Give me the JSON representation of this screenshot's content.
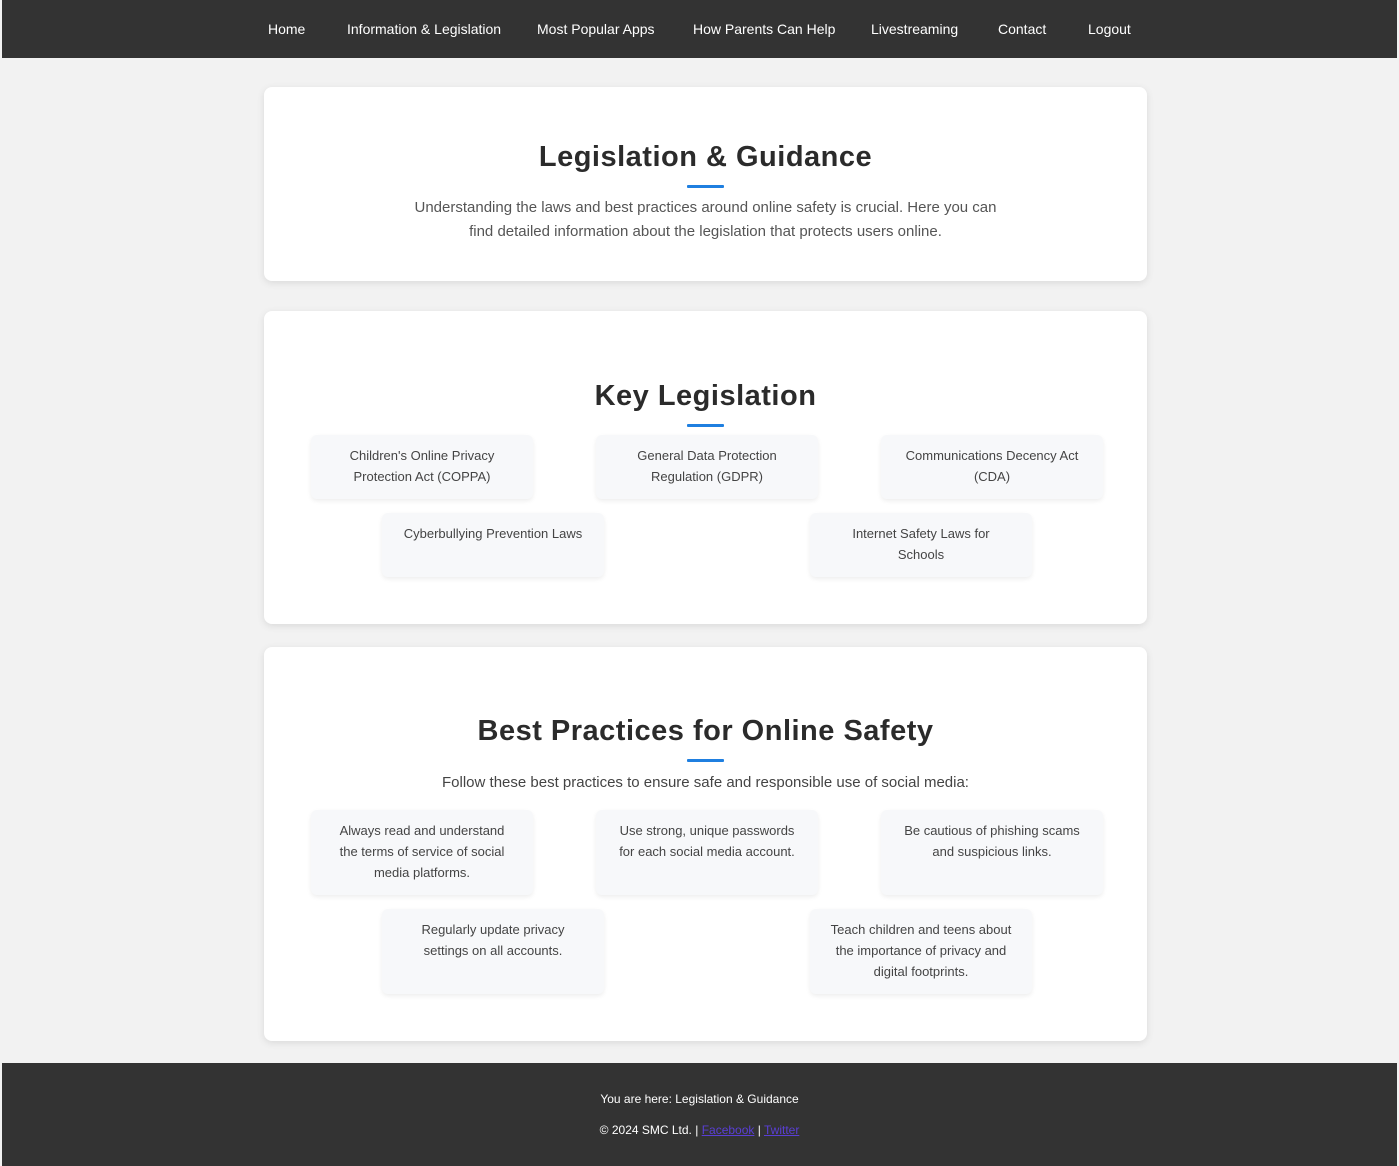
{
  "nav": {
    "home": "Home",
    "info": "Information & Legislation",
    "apps": "Most Popular Apps",
    "parents": "How Parents Can Help",
    "live": "Livestreaming",
    "contact": "Contact",
    "logout": "Logout"
  },
  "hero": {
    "title": "Legislation & Guidance",
    "text": "Understanding the laws and best practices around online safety is crucial. Here you can find detailed information about the legislation that protects users online."
  },
  "legislation": {
    "title": "Key Legislation",
    "items": [
      "Children's Online Privacy Protection Act (COPPA)",
      "General Data Protection Regulation (GDPR)",
      "Communications Decency Act (CDA)",
      "Cyberbullying Prevention Laws",
      "Internet Safety Laws for Schools"
    ]
  },
  "practices": {
    "title": "Best Practices for Online Safety",
    "subtitle": "Follow these best practices to ensure safe and responsible use of social media:",
    "items": [
      "Always read and understand the terms of service of social media platforms.",
      "Use strong, unique passwords for each social media account.",
      "Be cautious of phishing scams and suspicious links.",
      "Regularly update privacy settings on all accounts.",
      "Teach children and teens about the importance of privacy and digital footprints."
    ]
  },
  "footer": {
    "breadcrumb": "You are here: Legislation & Guidance",
    "copyright": "© 2024 SMC Ltd. |",
    "separator": "|",
    "link1": "Facebook",
    "link2": "Twitter"
  },
  "colors": {
    "nav_bg": "#333333",
    "accent": "#1f7fe0",
    "page_bg": "#f2f2f2"
  }
}
